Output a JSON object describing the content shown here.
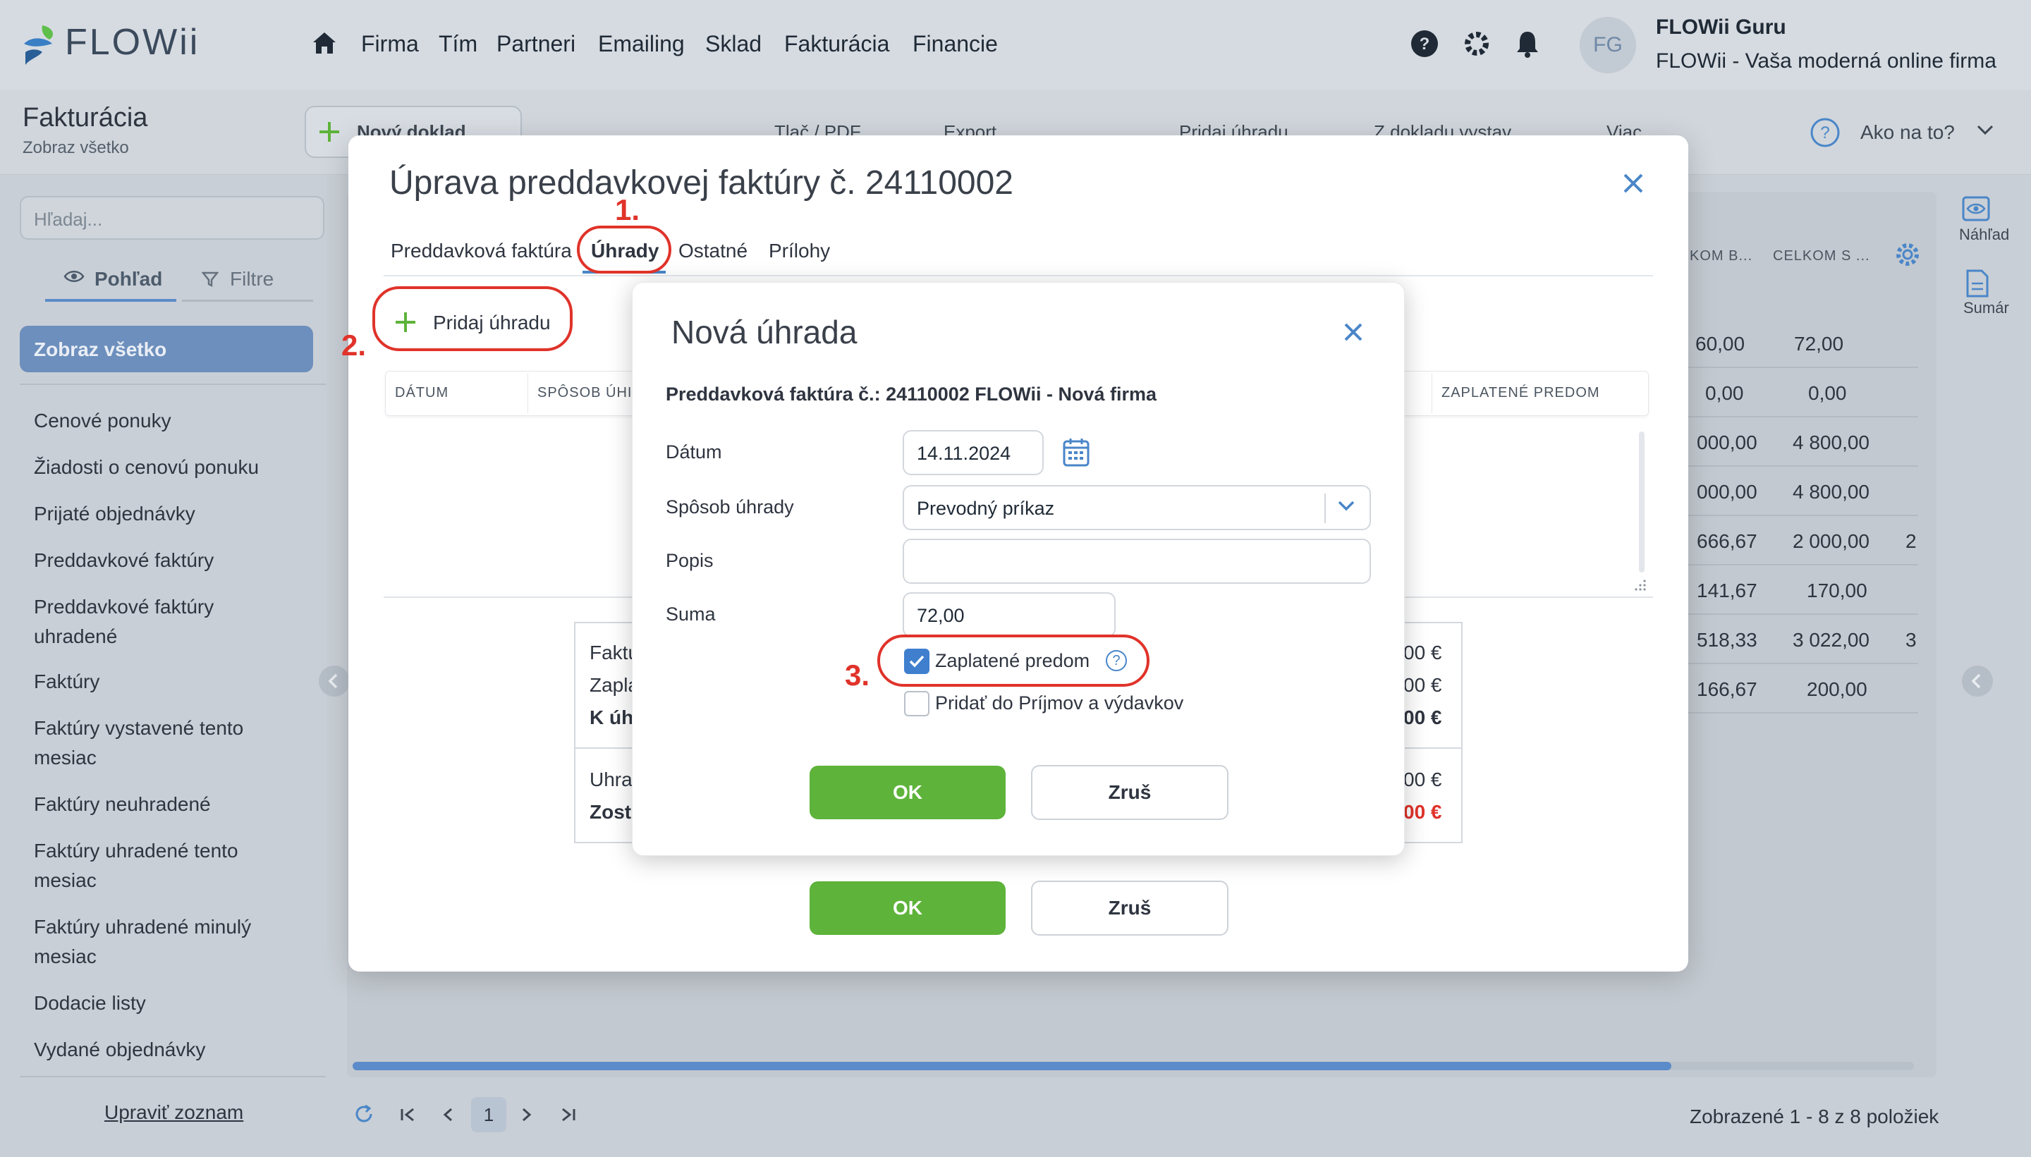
{
  "app": {
    "brand": "FLOWii",
    "nav": [
      "Firma",
      "Tím",
      "Partneri",
      "Emailing",
      "Sklad",
      "Fakturácia",
      "Financie"
    ],
    "user": {
      "initials": "FG",
      "name": "FLOWii Guru",
      "company": "FLOWii - Vaša moderná online firma"
    }
  },
  "toolbar": {
    "section_title": "Fakturácia",
    "section_sub": "Zobraz všetko",
    "new_doc": "Nový doklad",
    "print": "Tlač / PDF",
    "export": "Export",
    "add_payment": "Pridaj úhradu",
    "from_doc": "Z dokladu vystav",
    "more": "Viac",
    "help": "Ako na to?"
  },
  "sidebar": {
    "search_placeholder": "Hľadaj...",
    "tab_view": "Pohľad",
    "tab_filter": "Filtre",
    "active": "Zobraz všetko",
    "items": [
      "Cenové ponuky",
      "Žiadosti o cenovú ponuku",
      "Prijaté objednávky",
      "Preddavkové faktúry",
      "Preddavkové faktúry uhradené",
      "Faktúry",
      "Faktúry vystavené tento mesiac",
      "Faktúry neuhradené",
      "Faktúry uhradené tento mesiac",
      "Faktúry uhradené minulý mesiac",
      "Dodacie listy",
      "Vydané objednávky"
    ],
    "edit_list": "Upraviť zoznam"
  },
  "grid": {
    "headers": [
      "KOM B...",
      "CELKOM S ..."
    ],
    "rows": [
      [
        "60,00",
        "72,00",
        ""
      ],
      [
        "0,00",
        "0,00",
        ""
      ],
      [
        "000,00",
        "4 800,00",
        ""
      ],
      [
        "000,00",
        "4 800,00",
        ""
      ],
      [
        "666,67",
        "2 000,00",
        "2"
      ],
      [
        "141,67",
        "170,00",
        ""
      ],
      [
        "518,33",
        "3 022,00",
        "3"
      ],
      [
        "166,67",
        "200,00",
        ""
      ]
    ],
    "right_panel": {
      "preview": "Náhľad",
      "summary": "Sumár"
    },
    "pager_page": "1",
    "pager_status": "Zobrazené 1 - 8 z 8 položiek"
  },
  "modal": {
    "title": "Úprava preddavkovej faktúry č. 24110002",
    "tabs": [
      "Preddavková faktúra",
      "Úhrady",
      "Ostatné",
      "Prílohy"
    ],
    "add_payment": "Pridaj úhradu",
    "table_headers": {
      "date": "DÁTUM",
      "method": "SPÔSOB ÚHI",
      "prepaid": "ZAPLATENÉ PREDOM"
    },
    "summary_left": [
      "Faktú",
      "Zapla",
      "K úh",
      "Uhra",
      "Zost"
    ],
    "summary_right": [
      "00 €",
      "00 €",
      "00 €",
      "00 €",
      "00 €"
    ],
    "ok": "OK",
    "cancel": "Zruš"
  },
  "dialog": {
    "title": "Nová úhrada",
    "subtitle": "Preddavková faktúra č.: 24110002 FLOWii - Nová firma",
    "labels": {
      "date": "Dátum",
      "method": "Spôsob úhrady",
      "desc": "Popis",
      "amount": "Suma"
    },
    "values": {
      "date": "14.11.2024",
      "method": "Prevodný príkaz",
      "desc": "",
      "amount": "72,00"
    },
    "checkbox_prepaid": "Zaplatené predom",
    "checkbox_prepaid_checked": true,
    "checkbox_income": "Pridať do Príjmov a výdavkov",
    "checkbox_income_checked": false,
    "ok": "OK",
    "cancel": "Zruš"
  },
  "annotations": [
    "1.",
    "2.",
    "3."
  ],
  "colors": {
    "accent": "#4a86c8",
    "ok_green": "#5eb33a",
    "annotation_red": "#e0332a",
    "negative_red": "#e0332a"
  }
}
